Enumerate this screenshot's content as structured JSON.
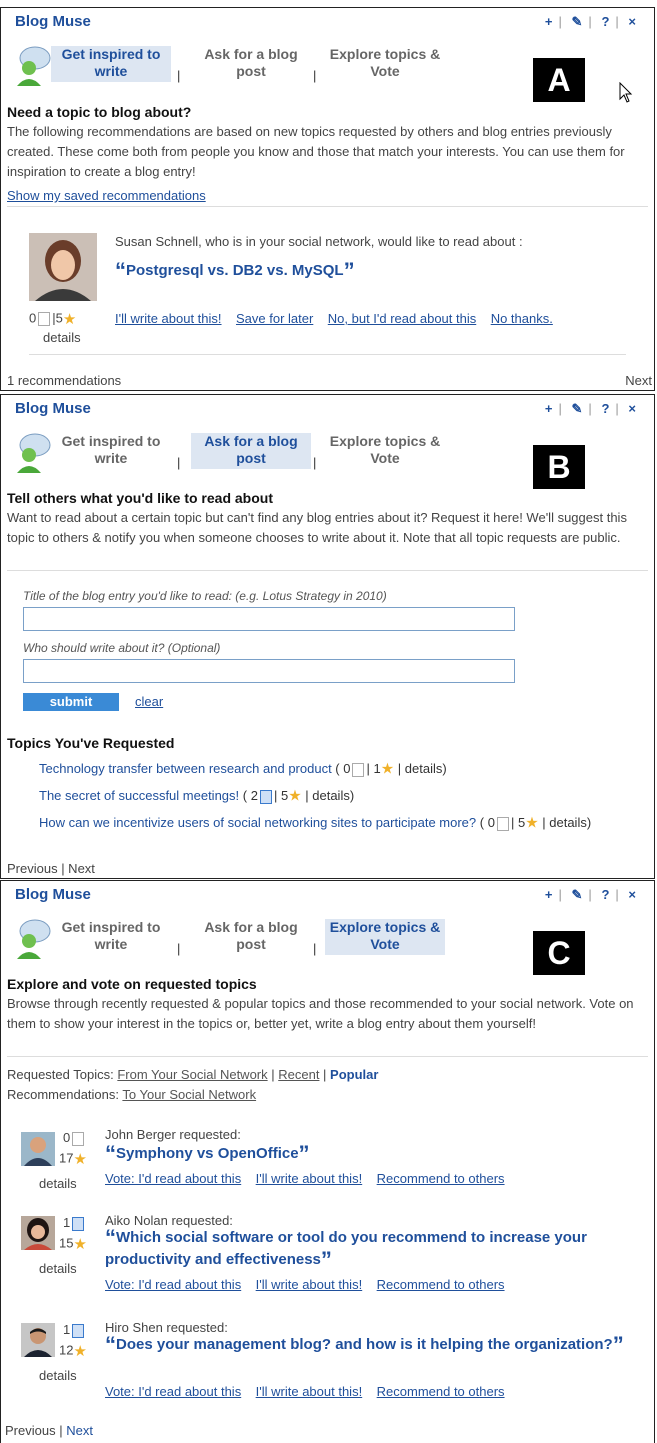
{
  "widget": {
    "title": "Blog Muse",
    "controls": {
      "add": "+",
      "edit": "✎",
      "help": "?",
      "close": "×"
    },
    "tabs": [
      {
        "label": "Get inspired to write"
      },
      {
        "label": "Ask for a blog post"
      },
      {
        "label": "Explore topics & Vote"
      }
    ]
  },
  "panelA": {
    "letter": "A",
    "heading": "Need a topic to blog about?",
    "description": "The following recommendations are based on new topics requested by others and blog entries previously created. These come both from people you know and those that match your interests. You can use them for inspiration to create a blog entry!",
    "saved_link": "Show my saved recommendations",
    "recommendation": {
      "requester_text": "Susan Schnell, who is in your social network, would like to read about :",
      "topic": "Postgresql vs. DB2 vs. MySQL",
      "doc_count": "0",
      "star_count": "5",
      "details": "details",
      "actions": [
        "I'll write about this!",
        "Save for later",
        "No, but I'd read about this",
        "No thanks."
      ]
    },
    "footer_count": "1 recommendations",
    "footer_next": "Next"
  },
  "panelB": {
    "letter": "B",
    "heading": "Tell others what you'd like to read about",
    "description": "Want to read about a certain topic but can't find any blog entries about it? Request it here! We'll suggest this topic to others & notify you when someone chooses to write about it. Note that all topic requests are public.",
    "title_label": "Title of the blog entry you'd like to read: (e.g. Lotus Strategy in 2010)",
    "who_label": "Who should write about it? (Optional)",
    "submit": "submit",
    "clear": "clear",
    "requested_heading": "Topics You've Requested",
    "requested": [
      {
        "title": "Technology transfer between research and product",
        "docs": "0",
        "stars": "1"
      },
      {
        "title": "The secret of successful meetings!",
        "docs": "2",
        "stars": "5"
      },
      {
        "title": "How can we incentivize users of social networking sites to participate more?",
        "docs": "0",
        "stars": "5"
      }
    ],
    "details": "details",
    "pager": "Previous | Next"
  },
  "panelC": {
    "letter": "C",
    "heading": "Explore and vote on requested topics",
    "description": "Browse through recently requested & popular topics and those recommended to your social network. Vote on them to show your interest in the topics or, better yet, write a blog entry about them yourself!",
    "requested_label": "Requested Topics:",
    "filter_social": "From Your Social Network",
    "filter_recent": "Recent",
    "filter_popular": "Popular",
    "recs_label": "Recommendations:",
    "recs_link": "To Your Social Network",
    "items": [
      {
        "requester": "John Berger requested:",
        "topic": "Symphony vs OpenOffice",
        "docs": "0",
        "stars": "17"
      },
      {
        "requester": "Aiko Nolan requested:",
        "topic": "Which social software or tool do you recommend to increase your productivity and effectiveness",
        "docs": "1",
        "stars": "15"
      },
      {
        "requester": "Hiro Shen requested:",
        "topic": "Does your management blog? and how is it helping the organization?",
        "docs": "1",
        "stars": "12"
      }
    ],
    "actions": [
      "Vote: I'd read about this",
      "I'll write about this!",
      "Recommend to others"
    ],
    "details": "details",
    "pager_prev": "Previous |",
    "pager_next": "Next"
  }
}
